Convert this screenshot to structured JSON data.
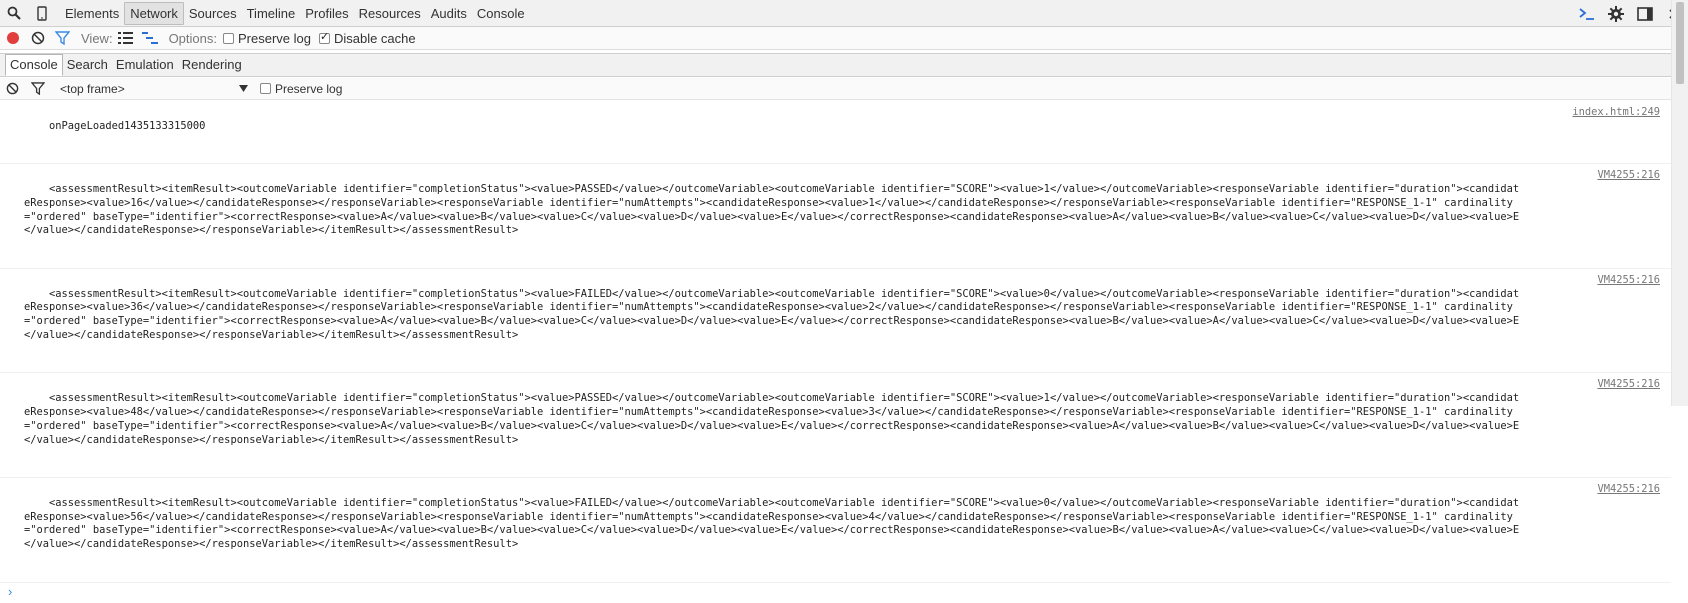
{
  "toolbar": {
    "tabs": [
      "Elements",
      "Network",
      "Sources",
      "Timeline",
      "Profiles",
      "Resources",
      "Audits",
      "Console"
    ],
    "selected_tab": "Network"
  },
  "network_toolbar": {
    "view_label": "View:",
    "options_label": "Options:",
    "preserve_log_label": "Preserve log",
    "preserve_log_checked": false,
    "disable_cache_label": "Disable cache",
    "disable_cache_checked": true
  },
  "drawer": {
    "tabs": [
      "Console",
      "Search",
      "Emulation",
      "Rendering"
    ],
    "selected_tab": "Console"
  },
  "console_toolbar": {
    "frame_select_value": "<top frame>",
    "preserve_log_label": "Preserve log",
    "preserve_log_checked": false
  },
  "messages": [
    {
      "text": "onPageLoaded1435133315000",
      "source": "index.html:249"
    },
    {
      "text": "<assessmentResult><itemResult><outcomeVariable identifier=\"completionStatus\"><value>PASSED</value></outcomeVariable><outcomeVariable identifier=\"SCORE\"><value>1</value></outcomeVariable><responseVariable identifier=\"duration\"><candidateResponse><value>16</value></candidateResponse></responseVariable><responseVariable identifier=\"numAttempts\"><candidateResponse><value>1</value></candidateResponse></responseVariable><responseVariable identifier=\"RESPONSE_1-1\" cardinality=\"ordered\" baseType=\"identifier\"><correctResponse><value>A</value><value>B</value><value>C</value><value>D</value><value>E</value></correctResponse><candidateResponse><value>A</value><value>B</value><value>C</value><value>D</value><value>E</value></candidateResponse></responseVariable></itemResult></assessmentResult>",
      "source": "VM4255:216"
    },
    {
      "text": "<assessmentResult><itemResult><outcomeVariable identifier=\"completionStatus\"><value>FAILED</value></outcomeVariable><outcomeVariable identifier=\"SCORE\"><value>0</value></outcomeVariable><responseVariable identifier=\"duration\"><candidateResponse><value>36</value></candidateResponse></responseVariable><responseVariable identifier=\"numAttempts\"><candidateResponse><value>2</value></candidateResponse></responseVariable><responseVariable identifier=\"RESPONSE_1-1\" cardinality=\"ordered\" baseType=\"identifier\"><correctResponse><value>A</value><value>B</value><value>C</value><value>D</value><value>E</value></correctResponse><candidateResponse><value>B</value><value>A</value><value>C</value><value>D</value><value>E</value></candidateResponse></responseVariable></itemResult></assessmentResult>",
      "source": "VM4255:216"
    },
    {
      "text": "<assessmentResult><itemResult><outcomeVariable identifier=\"completionStatus\"><value>PASSED</value></outcomeVariable><outcomeVariable identifier=\"SCORE\"><value>1</value></outcomeVariable><responseVariable identifier=\"duration\"><candidateResponse><value>48</value></candidateResponse></responseVariable><responseVariable identifier=\"numAttempts\"><candidateResponse><value>3</value></candidateResponse></responseVariable><responseVariable identifier=\"RESPONSE_1-1\" cardinality=\"ordered\" baseType=\"identifier\"><correctResponse><value>A</value><value>B</value><value>C</value><value>D</value><value>E</value></correctResponse><candidateResponse><value>A</value><value>B</value><value>C</value><value>D</value><value>E</value></candidateResponse></responseVariable></itemResult></assessmentResult>",
      "source": "VM4255:216"
    },
    {
      "text": "<assessmentResult><itemResult><outcomeVariable identifier=\"completionStatus\"><value>FAILED</value></outcomeVariable><outcomeVariable identifier=\"SCORE\"><value>0</value></outcomeVariable><responseVariable identifier=\"duration\"><candidateResponse><value>56</value></candidateResponse></responseVariable><responseVariable identifier=\"numAttempts\"><candidateResponse><value>4</value></candidateResponse></responseVariable><responseVariable identifier=\"RESPONSE_1-1\" cardinality=\"ordered\" baseType=\"identifier\"><correctResponse><value>A</value><value>B</value><value>C</value><value>D</value><value>E</value></correctResponse><candidateResponse><value>B</value><value>A</value><value>C</value><value>D</value><value>E</value></candidateResponse></responseVariable></itemResult></assessmentResult>",
      "source": "VM4255:216"
    }
  ],
  "prompt_symbol": "›",
  "icons": {
    "top_left": [
      "search-icon",
      "mobile-device-icon"
    ],
    "top_right": [
      "console-drawer-icon",
      "gear-icon",
      "dock-icon",
      "close-icon"
    ],
    "network": [
      "record-icon",
      "clear-icon",
      "filter-icon",
      "list-view-icon",
      "waterfall-icon"
    ],
    "console": [
      "clear-icon",
      "filter-icon",
      "dropdown-arrow-icon"
    ]
  },
  "colors": {
    "record": "#e23d3d",
    "filter": "#3b8ae6",
    "link": "#777777",
    "prompt": "#3b8ae6"
  }
}
